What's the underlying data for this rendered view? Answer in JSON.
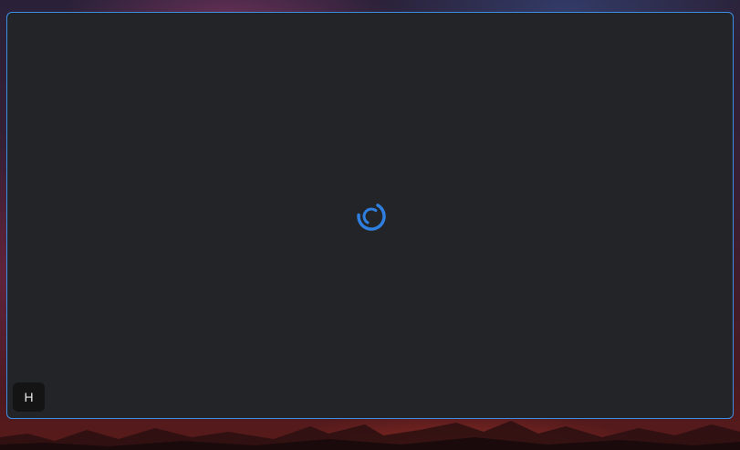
{
  "window": {
    "state": "loading",
    "accent_color": "#3d8fe6",
    "background_color": "#232428"
  },
  "spinner": {
    "icon": "loading-spinner-icon",
    "color": "#2f7fe0"
  },
  "hint_badge": {
    "label": "H"
  }
}
